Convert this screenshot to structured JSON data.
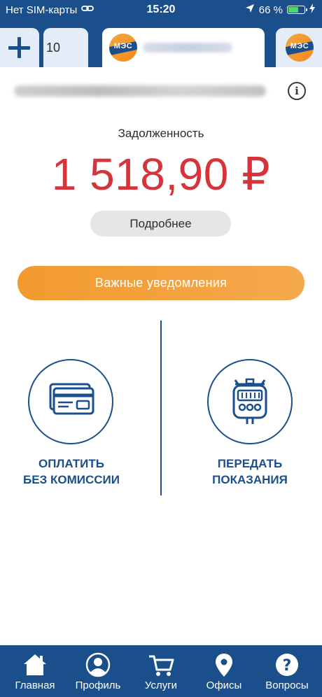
{
  "status_bar": {
    "carrier": "Нет SIM-карты",
    "time": "15:20",
    "battery_percent": "66 %",
    "battery_level": 0.66
  },
  "tabs": {
    "prev_tab_label": "10",
    "logo_text": "МЭС"
  },
  "debt": {
    "label": "Задолженность",
    "amount": "1 518,90 ₽",
    "details_label": "Подробнее"
  },
  "notices_label": "Важные уведомления",
  "actions": {
    "pay_line1": "ОПЛАТИТЬ",
    "pay_line2": "БЕЗ КОМИССИИ",
    "meter_line1": "ПЕРЕДАТЬ",
    "meter_line2": "ПОКАЗАНИЯ"
  },
  "nav": [
    {
      "label": "Главная",
      "icon": "home-icon"
    },
    {
      "label": "Профиль",
      "icon": "profile-icon"
    },
    {
      "label": "Услуги",
      "icon": "cart-icon"
    },
    {
      "label": "Офисы",
      "icon": "location-pin-icon"
    },
    {
      "label": "Вопросы",
      "icon": "question-icon"
    }
  ],
  "colors": {
    "brand_blue": "#1b4f8c",
    "debt_red": "#d6343a",
    "accent_orange": "#f29a2e"
  }
}
